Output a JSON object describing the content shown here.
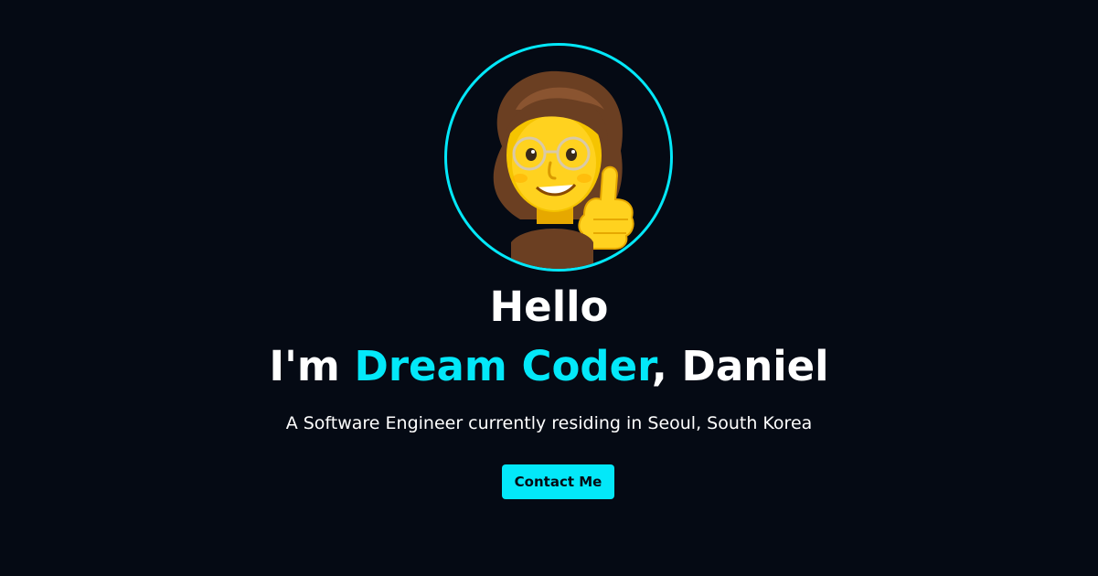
{
  "home": {
    "avatar_alt": "memoji avatar with thumbs up",
    "greeting": "Hello",
    "intro_prefix": "I'm ",
    "intro_highlight": "Dream Coder",
    "intro_suffix": ", Daniel",
    "description": "A Software Engineer currently residing in Seoul, South Korea",
    "contact_label": "Contact Me"
  },
  "colors": {
    "background": "#050a14",
    "accent": "#03e8f9",
    "text": "#ffffff"
  }
}
